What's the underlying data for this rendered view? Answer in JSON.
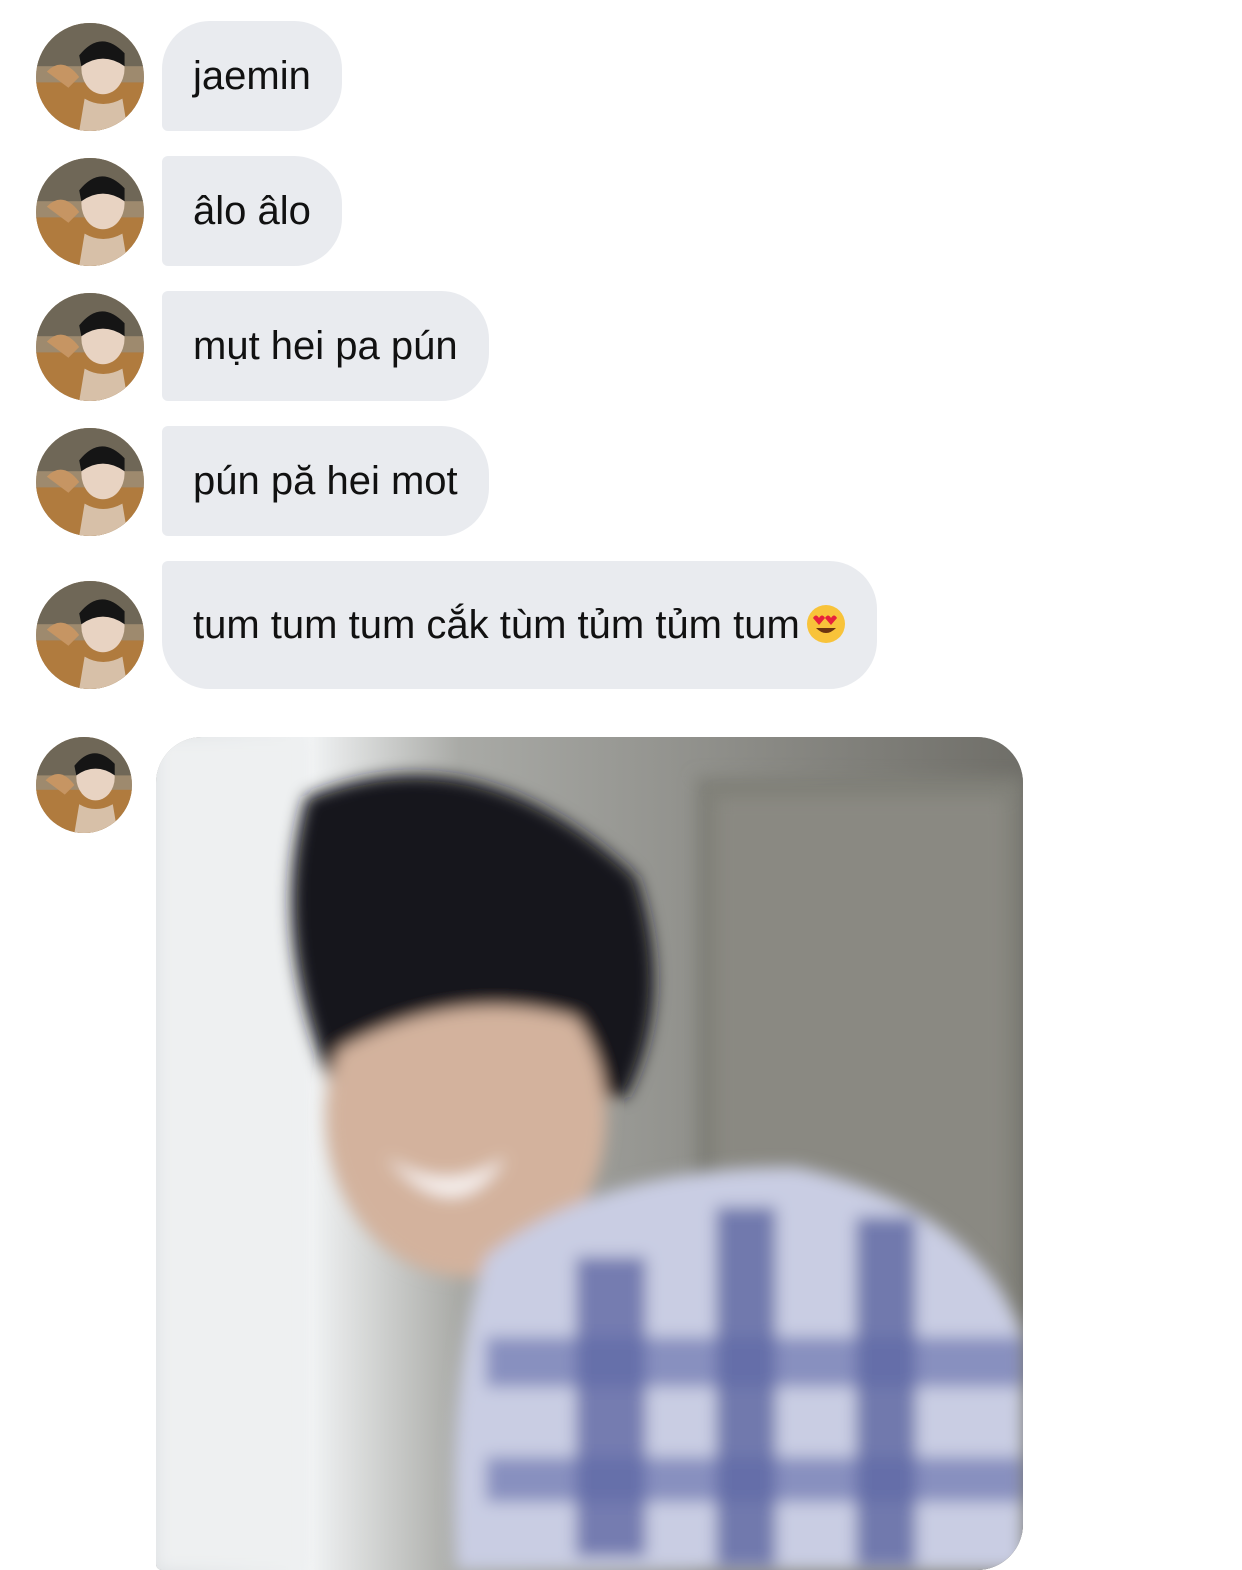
{
  "thread": {
    "sender_avatar_icon": "profile-photo-avatar",
    "messages": [
      {
        "type": "text",
        "text": "jaemin"
      },
      {
        "type": "text",
        "text": "âlo âlo"
      },
      {
        "type": "text",
        "text": "mụt hei pa pún"
      },
      {
        "type": "text",
        "text": "pún pă hei mot"
      },
      {
        "type": "text",
        "text": "tum tum tum cắk tùm tủm tủm tum",
        "emoji": "heart-eyes-emoji"
      },
      {
        "type": "image",
        "image_icon": "photo-attachment"
      }
    ]
  },
  "colors": {
    "bubble_background": "#e9ebef",
    "text": "#111111",
    "page_background": "#ffffff"
  }
}
